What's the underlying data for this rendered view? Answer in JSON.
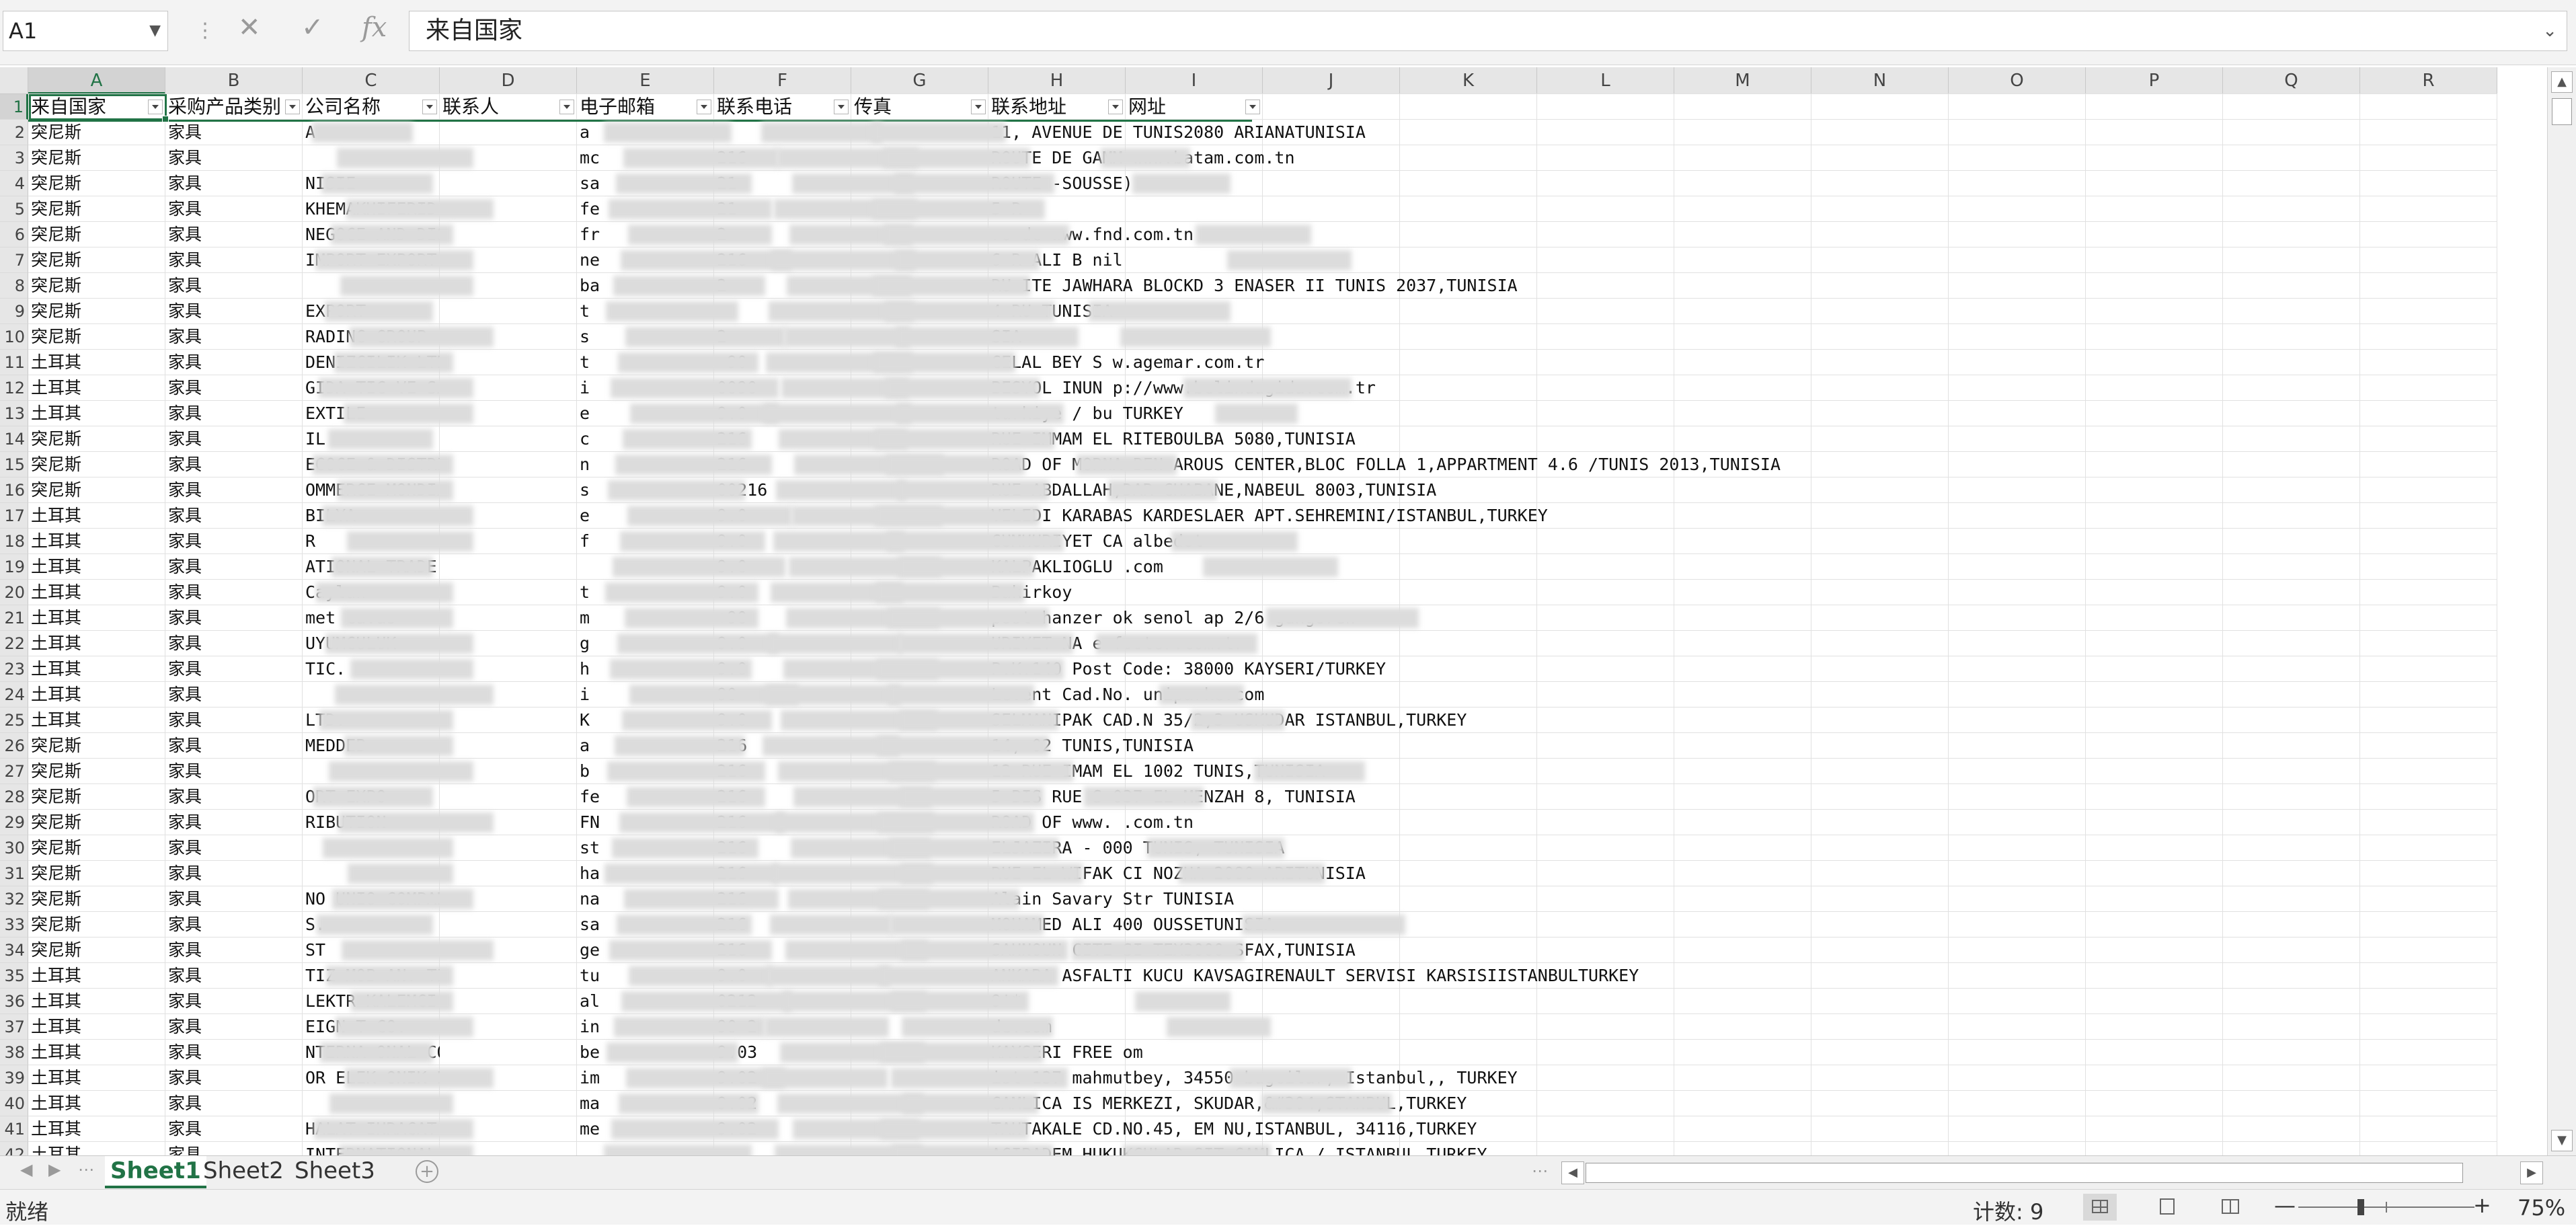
{
  "formula_bar": {
    "name_box": "A1",
    "cancel_icon": "✕",
    "enter_icon": "✓",
    "fx_icon": "fx",
    "formula": "来自国家"
  },
  "columns": [
    "A",
    "B",
    "C",
    "D",
    "E",
    "F",
    "G",
    "H",
    "I",
    "J",
    "K",
    "L",
    "M",
    "N",
    "O",
    "P",
    "Q",
    "R"
  ],
  "header_row": {
    "number": "1",
    "cells": [
      "来自国家",
      "采购产品类别",
      "公司名称",
      "联系人",
      "电子邮箱",
      "联系电话",
      "传真",
      "联系地址",
      "网址"
    ]
  },
  "rows": [
    {
      "n": "2",
      "a": "突尼斯",
      "b": "家具",
      "c": "A",
      "d": "",
      "e": "a",
      "f": "",
      "g": "",
      "h": "11, AVENUE DE TUNIS2080  ARIANATUNISIA"
    },
    {
      "n": "3",
      "a": "突尼斯",
      "b": "家具",
      "c": "",
      "d": "",
      "e": "mc",
      "f": "216",
      "g": "",
      "h": "ROUTE DE GAMM www.batam.com.tn"
    },
    {
      "n": "4",
      "a": "突尼斯",
      "b": "家具",
      "c": "NISIE",
      "d": "",
      "e": "sa",
      "f": "21",
      "g": "",
      "h": "ROUTE -SOUSSE)"
    },
    {
      "n": "5",
      "a": "突尼斯",
      "b": "家具",
      "c": "KHEMAKHIFERID KHEMAKH",
      "d": "",
      "e": "fe",
      "f": "21",
      "g": "",
      "h": "5 R"
    },
    {
      "n": "6",
      "a": "突尼斯",
      "b": "家具",
      "c": "NEGOCE AND DISTRIBUTI",
      "d": "",
      "e": "fr",
      "f": "2",
      "g": "",
      "h": "ro de www.fnd.com.tn"
    },
    {
      "n": "7",
      "a": "突尼斯",
      "b": "家具",
      "c": "IMPORT-EXPORT COMME",
      "d": "",
      "e": "ne",
      "f": "216",
      "g": "",
      "h": "6 R ALI B nil"
    },
    {
      "n": "8",
      "a": "突尼斯",
      "b": "家具",
      "c": "",
      "d": "",
      "e": "ba",
      "f": "2",
      "g": "",
      "h": "RU ITE JAWHARA BLOCKD 3 ENASER II TUNIS 2037,TUNISIA"
    },
    {
      "n": "9",
      "a": "突尼斯",
      "b": "家具",
      "c": "EXPORT",
      "d": "",
      "e": "t",
      "f": "",
      "g": "",
      "h": "4 RU TUNISIA"
    },
    {
      "n": "10",
      "a": "突尼斯",
      "b": "家具",
      "c": "RADING GROUP",
      "d": "",
      "e": "s",
      "f": "2",
      "g": "",
      "h": "SIA"
    },
    {
      "n": "11",
      "a": "土耳其",
      "b": "家具",
      "c": "DENIZCILIK LTD",
      "d": "",
      "e": "t",
      "f": "+90",
      "g": "",
      "h": "CELAL BEY S w.agemar.com.tr"
    },
    {
      "n": "12",
      "a": "土耳其",
      "b": "家具",
      "c": "GIDA TIC VE SAN.LTD",
      "d": "",
      "e": "i",
      "f": "0090-",
      "g": "",
      "h": "BESYOL INUN p://www.belindagida.com.tr"
    },
    {
      "n": "13",
      "a": "土耳其",
      "b": "家具",
      "c": "EXTILE",
      "d": "",
      "e": "e",
      "f": "9.0",
      "g": "",
      "h": "turkiye / bu  TURKEY"
    },
    {
      "n": "14",
      "a": "突尼斯",
      "b": "家具",
      "c": "IL",
      "d": "",
      "e": "c",
      "f": "216",
      "g": "",
      "h": "RUE IMMAM EL RITEBOULBA 5080,TUNISIA"
    },
    {
      "n": "15",
      "a": "突尼斯",
      "b": "家具",
      "c": "EGOCE & DISTRIBUTION",
      "d": "",
      "e": "n",
      "f": "216",
      "g": "",
      "h": "ROAD OF MORNA BEN AROUS CENTER,BLOC FOLLA 1,APPARTMENT 4.6 /TUNIS 2013,TUNISIA"
    },
    {
      "n": "16",
      "a": "突尼斯",
      "b": "家具",
      "c": "OMMERCE MONDIAL",
      "d": "",
      "e": "s",
      "f": "00216",
      "g": "",
      "h": "RUE ABDALLAH,DAR CHABANE,NABEUL 8003,TUNISIA"
    },
    {
      "n": "17",
      "a": "土耳其",
      "b": "家具",
      "c": "BILYA",
      "d": "",
      "e": "e",
      "f": "9.0",
      "g": "",
      "h": "VELEDI KARABAS KARDESLAER APT.SEHREMINI/ISTANBUL,TURKEY"
    },
    {
      "n": "18",
      "a": "土耳其",
      "b": "家具",
      "c": "R",
      "d": "",
      "e": "f",
      "f": "9.0",
      "g": "",
      "h": "CUMHURIYET CA albedot"
    },
    {
      "n": "19",
      "a": "土耳其",
      "b": "家具",
      "c": "ATIONAL TRADE & C",
      "d": "",
      "e": "",
      "f": "9.0",
      "g": "",
      "h": "KALPAKLIOGLU  .com"
    },
    {
      "n": "20",
      "a": "土耳其",
      "b": "家具",
      "c": "Caylan",
      "d": "",
      "e": "t",
      "f": "9.0",
      "g": "",
      "h": "Bakirkoy"
    },
    {
      "n": "21",
      "a": "土耳其",
      "b": "家具",
      "c": "met cavas",
      "d": "",
      "e": "m",
      "f": "+90",
      "g": "",
      "h": "post hanzer ok senol ap 2/6 gungoren"
    },
    {
      "n": "22",
      "a": "土耳其",
      "b": "家具",
      "c": "UYUMCULUK",
      "d": "",
      "e": "g",
      "f": "9.0",
      "g": "",
      "h": "URIYET NA e-footer.com.tr"
    },
    {
      "n": "23",
      "a": "土耳其",
      "b": "家具",
      "c": "TIC.",
      "d": "",
      "e": "h",
      "f": "9.0",
      "g": "",
      "h": "P.K.140          Post Code: 38000       KAYSERI/TURKEY"
    },
    {
      "n": "24",
      "a": "土耳其",
      "b": "家具",
      "c": "",
      "d": "",
      "e": "i",
      "f": "90",
      "g": "",
      "h": "Levent Cad.No. uniparke.com"
    },
    {
      "n": "25",
      "a": "土耳其",
      "b": "家具",
      "c": "LTD.",
      "d": "",
      "e": "K",
      "f": "9.0",
      "g": "",
      "h": "SELMANIPAK CAD.N 35/2,3 USKUDAR ISTANBUL,TURKEY"
    },
    {
      "n": "26",
      "a": "突尼斯",
      "b": "家具",
      "c": "MEDDEB",
      "d": "",
      "e": "a",
      "f": "216",
      "g": "",
      "h": "14, 02 TUNIS,TUNISIA"
    },
    {
      "n": "27",
      "a": "突尼斯",
      "b": "家具",
      "c": "",
      "d": "",
      "e": "b",
      "f": "216",
      "g": "",
      "h": "12 RUE IMAM EL 1002 TUNIS,TUNISIA"
    },
    {
      "n": "28",
      "a": "突尼斯",
      "b": "家具",
      "c": "ORT EXPO",
      "d": "",
      "e": "fe",
      "f": "216",
      "g": "",
      "h": "5 BIS RUE S 037 EL MENZAH 8, TUNISIA"
    },
    {
      "n": "29",
      "a": "突尼斯",
      "b": "家具",
      "c": "RIBUTION",
      "d": "",
      "e": "FN",
      "f": "216",
      "g": "",
      "h": "ROAD OF www. .com.tn"
    },
    {
      "n": "30",
      "a": "突尼斯",
      "b": "家具",
      "c": "",
      "d": "",
      "e": "st",
      "f": "216",
      "g": "",
      "h": "ELJAZIRA - 000 TUNIS, TUNISIA"
    },
    {
      "n": "31",
      "a": "突尼斯",
      "b": "家具",
      "c": "",
      "d": "",
      "e": "ha",
      "f": "216",
      "g": "",
      "h": "RUE EL WIFAK CI NOZHA 2080 ARITUNISIA"
    },
    {
      "n": "32",
      "a": "突尼斯",
      "b": "家具",
      "c": "NO UNIO COMPAN",
      "d": "",
      "e": "na",
      "f": "216",
      "g": "",
      "h": "Alain Savary Str TUNISIA"
    },
    {
      "n": "33",
      "a": "突尼斯",
      "b": "家具",
      "c": "S.",
      "d": "",
      "e": "sa",
      "f": "216",
      "g": "",
      "h": "MOHAMED ALI 400 OUSSETUNISIA"
    },
    {
      "n": "34",
      "a": "突尼斯",
      "b": "家具",
      "c": "ST",
      "d": "",
      "e": "ge",
      "f": "216",
      "g": "",
      "h": "SAHNOUN CITE SI TEX3000 SFAX,TUNISIA"
    },
    {
      "n": "35",
      "a": "土耳其",
      "b": "家具",
      "c": "TIZ MOB AN. TIC",
      "d": "",
      "e": "tu",
      "f": "9.0",
      "g": "",
      "h": "ANKARA ASFALTI KUCU KAVSAGIRENAULT SERVISI KARSISIISTANBULTURKEY"
    },
    {
      "n": "36",
      "a": "土耳其",
      "b": "家具",
      "c": "LEKTR KALEMCI",
      "d": "",
      "e": "al",
      "f": "0212",
      "g": "",
      "h": "9'*"
    },
    {
      "n": "37",
      "a": "土耳其",
      "b": "家具",
      "c": "EIGN T CO.",
      "d": "",
      "e": "in",
      "f": "90-2",
      "g": "",
      "h": "de.com"
    },
    {
      "n": "38",
      "a": "土耳其",
      "b": "家具",
      "c": "NTERNA ONAL CO.LTD",
      "d": "",
      "e": "be",
      "f": "9.03",
      "g": "",
      "h": "KAYSERI FREE om"
    },
    {
      "n": "39",
      "a": "土耳其",
      "b": "家具",
      "c": "OR ELEK ONIK BILISI",
      "d": "",
      "e": "im",
      "f": "9.02",
      "g": "",
      "h": "ist 137 mahmutbey, 34550 bagcilar, Istanbul,, TURKEY"
    },
    {
      "n": "40",
      "a": "土耳其",
      "b": "家具",
      "c": "",
      "d": "",
      "e": "ma",
      "f": "9.02",
      "g": "",
      "h": "CAMLICA IS MERKEZI, SKUDAR,&#304;STANBUL,TURKEY"
    },
    {
      "n": "41",
      "a": "土耳其",
      "b": "家具",
      "c": "HALAT IHRACAT TIC.L",
      "d": "",
      "e": "me",
      "f": "9.02",
      "g": "",
      "h": "TAHTAKALE CD.NO.45, EM NU,ISTANBUL, 34116,TURKEY"
    },
    {
      "n": "42",
      "a": "土耳其",
      "b": "家具",
      "c": "INTERNATIONAL CORP",
      "d": "",
      "e": "",
      "f": "",
      "g": "",
      "h": "ACIBADEM HUKUKCULAR SIT CAMLICA / ISTANBUL TURKEY"
    }
  ],
  "tabs": [
    "Sheet1",
    "Sheet2",
    "Sheet3"
  ],
  "tab_nav": {
    "prev": "◀",
    "next": "▶",
    "more": "⋯",
    "add": "+"
  },
  "status": {
    "ready": "就绪",
    "count": "计数: 9",
    "zoom_minus": "—",
    "zoom_plus": "+",
    "zoom_level": "75%"
  }
}
